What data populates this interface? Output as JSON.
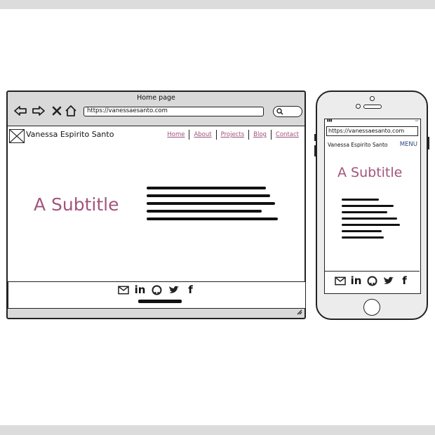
{
  "desktop": {
    "window_title": "Home page",
    "url": "https://vanessaesanto.com",
    "site_name": "Vanessa Espirito Santo",
    "nav": [
      "Home",
      "About",
      "Projects",
      "Blog",
      "Contact"
    ],
    "subtitle": "A Subtitle"
  },
  "mobile": {
    "url": "https://vanessaesanto.com",
    "site_name": "Vanessa Espirito Santo",
    "menu_label": "MENU",
    "subtitle": "A Subtitle"
  },
  "social_icons": [
    "mail-icon",
    "linkedin-icon",
    "github-icon",
    "twitter-icon",
    "facebook-icon"
  ],
  "colors": {
    "accent": "#a2557d",
    "menu": "#2c4a86"
  }
}
